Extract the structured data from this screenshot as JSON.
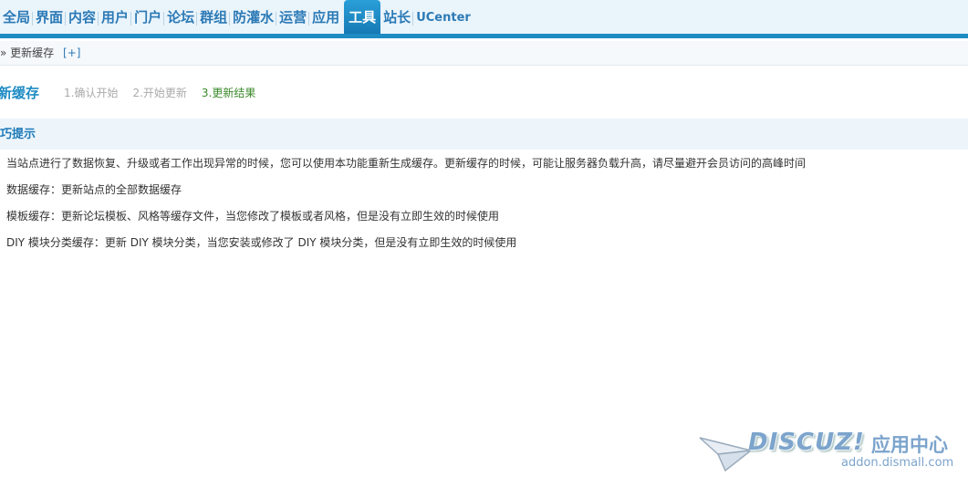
{
  "nav": {
    "items": [
      {
        "label": "全局"
      },
      {
        "label": "界面"
      },
      {
        "label": "内容"
      },
      {
        "label": "用户"
      },
      {
        "label": "门户"
      },
      {
        "label": "论坛"
      },
      {
        "label": "群组"
      },
      {
        "label": "防灌水"
      },
      {
        "label": "运营"
      },
      {
        "label": "应用"
      },
      {
        "label": "工具"
      },
      {
        "label": "站长"
      },
      {
        "label": "UCenter"
      }
    ],
    "active_index": 10
  },
  "breadcrumb": {
    "sep": "»",
    "current": "更新缓存",
    "add": "[+]"
  },
  "page": {
    "title": "新缓存",
    "steps": [
      {
        "label": "1.确认开始"
      },
      {
        "label": "2.开始更新"
      },
      {
        "label": "3.更新结果"
      }
    ],
    "current_step": 3
  },
  "tips": {
    "title": "巧提示",
    "lines": [
      "当站点进行了数据恢复、升级或者工作出现异常的时候，您可以使用本功能重新生成缓存。更新缓存的时候，可能让服务器负载升高，请尽量避开会员访问的高峰时间",
      "数据缓存：更新站点的全部数据缓存",
      "模板缓存：更新论坛模板、风格等缓存文件，当您修改了模板或者风格，但是没有立即生效的时候使用",
      "DIY 模块分类缓存：更新 DIY 模块分类，当您安装或修改了 DIY 模块分类，但是没有立即生效的时候使用"
    ]
  },
  "watermark": {
    "logo": "DISCUZ!",
    "cn": "应用中心",
    "url": "addon.dismall.com"
  },
  "colors": {
    "accent": "#1e8bc3",
    "step_done": "#3a8a2a"
  }
}
